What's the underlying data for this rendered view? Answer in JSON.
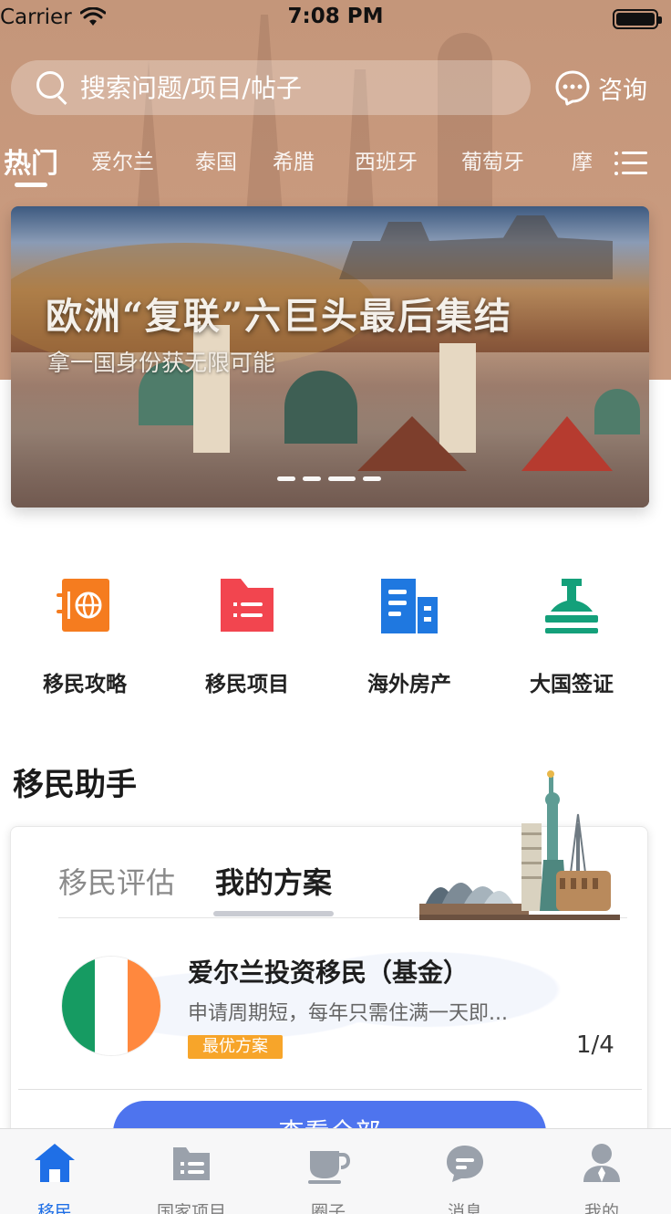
{
  "status_bar": {
    "carrier": "Carrier",
    "time": "7:08 PM"
  },
  "search": {
    "placeholder": "搜索问题/项目/帖子"
  },
  "consult": {
    "label": "咨询",
    "icon": "chat-bubble-icon"
  },
  "tabs": [
    {
      "label": "热门",
      "active": true
    },
    {
      "label": "爱尔兰"
    },
    {
      "label": "泰国"
    },
    {
      "label": "希腊"
    },
    {
      "label": "西班牙"
    },
    {
      "label": "葡萄牙"
    },
    {
      "label": "摩"
    }
  ],
  "banner": {
    "title": "欧洲“复联”六巨头最后集结",
    "subtitle": "拿一国身份获无限可能",
    "slides": 4,
    "active_slide": 3
  },
  "quick_actions": [
    {
      "label": "移民攻略",
      "icon": "passport-icon",
      "color": "#f57c1f"
    },
    {
      "label": "移民项目",
      "icon": "folder-icon",
      "color": "#f2454f"
    },
    {
      "label": "海外房产",
      "icon": "building-icon",
      "color": "#1f78e0"
    },
    {
      "label": "大国签证",
      "icon": "stamp-icon",
      "color": "#14a07a"
    }
  ],
  "assistant": {
    "title": "移民助手",
    "tabs": [
      {
        "label": "移民评估",
        "active": false
      },
      {
        "label": "我的方案",
        "active": true
      }
    ],
    "plan": {
      "title": "爱尔兰投资移民（基金）",
      "description": "申请周期短，每年只需住满一天即...",
      "badge": "最优方案",
      "pager": "1/4",
      "flag_colors": [
        "#169b62",
        "#ffffff",
        "#ff883e"
      ]
    },
    "view_all": "查看全部"
  },
  "tabbar": [
    {
      "label": "移民",
      "icon": "home-icon",
      "active": true
    },
    {
      "label": "国家项目",
      "icon": "list-card-icon"
    },
    {
      "label": "圈子",
      "icon": "cup-icon"
    },
    {
      "label": "消息",
      "icon": "message-icon"
    },
    {
      "label": "我的",
      "icon": "profile-icon"
    }
  ],
  "colors": {
    "accent": "#1f6fe6",
    "button": "#4e74ee",
    "header": "#c4967a"
  }
}
